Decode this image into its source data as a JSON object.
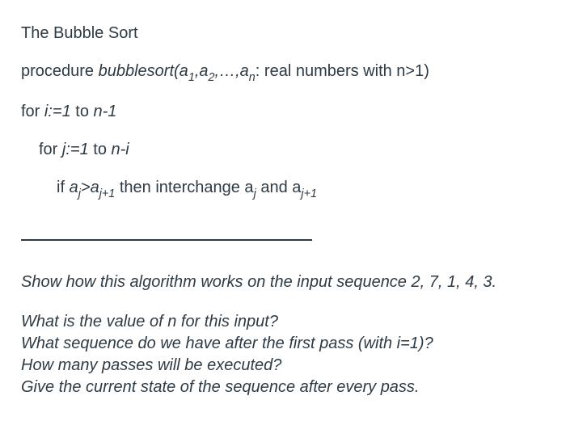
{
  "title": "The Bubble Sort",
  "proc": {
    "kw": "procedure ",
    "name": "bubblesort(a",
    "s1": "1",
    "c1": ",a",
    "s2": "2",
    "c2": ",…,a",
    "sn": "n",
    "tail": ": real numbers with n>1)"
  },
  "for_i": {
    "pre": "for ",
    "var": "i:=1",
    "post": " to ",
    "end": "n-1"
  },
  "for_j": {
    "pre": "for ",
    "var": "j:=1",
    "post": " to ",
    "end": "n-i"
  },
  "ifline": {
    "pre": "if ",
    "a1": "a",
    "s1": "j",
    "gt": ">a",
    "s2": "j+1",
    "mid": " then interchange a",
    "s3": "j",
    "mid2": "  and a",
    "s4": "j+1"
  },
  "prompt1": "Show how this algorithm works on the input sequence 2, 7, 1, 4, 3.",
  "q1": "What is the value of n for this input?",
  "q2": "What sequence do we have after the first pass (with i=1)?",
  "q3": "How many passes will be executed?",
  "q4": "Give the current state of the sequence after every pass."
}
